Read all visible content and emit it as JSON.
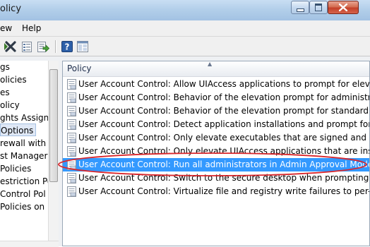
{
  "window": {
    "title": "olicy"
  },
  "menu": {
    "items": [
      {
        "label": "ew"
      },
      {
        "label": "Help"
      }
    ]
  },
  "tree": {
    "nodes": [
      {
        "label": "gs"
      },
      {
        "label": "olicies"
      },
      {
        "label": "es"
      },
      {
        "label": "olicy"
      },
      {
        "label": "ghts Assignm"
      },
      {
        "label": "Options",
        "selected": true
      },
      {
        "label": "rewall with A"
      },
      {
        "label": "st Manager P"
      },
      {
        "label": "Policies"
      },
      {
        "label": "estriction Pol"
      },
      {
        "label": " Control Pol"
      },
      {
        "label": "Policies on L"
      }
    ]
  },
  "list": {
    "header": "Policy",
    "rows": [
      {
        "text": "User Account Control: Allow UIAccess applications to prompt for elevati"
      },
      {
        "text": "User Account Control: Behavior of the elevation prompt for administrato"
      },
      {
        "text": "User Account Control: Behavior of the elevation prompt for standard use"
      },
      {
        "text": "User Account Control: Detect application installations and prompt for ele"
      },
      {
        "text": "User Account Control: Only elevate executables that are signed and valid"
      },
      {
        "text": "User Account Control: Only elevate UIAccess applications that are installe"
      },
      {
        "text": "User Account Control: Run all administrators in Admin Approval Mode",
        "selected": true
      },
      {
        "text": "User Account Control: Switch to the secure desktop when prompting for"
      },
      {
        "text": "User Account Control: Virtualize file and registry write failures to per-user"
      }
    ]
  },
  "colors": {
    "selection": "#3399ff",
    "highlight_ring": "#d9262b"
  },
  "icons": [
    "minimize-icon",
    "maximize-icon",
    "close-icon",
    "delete-icon",
    "properties-icon",
    "export-icon",
    "help-icon",
    "view-icon",
    "policy-icon",
    "sort-up-icon"
  ]
}
